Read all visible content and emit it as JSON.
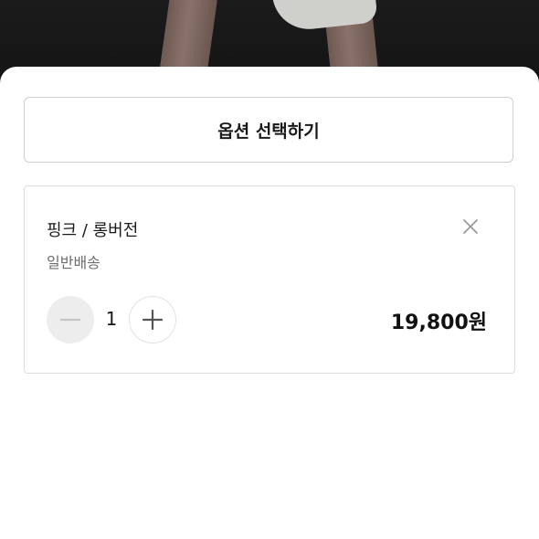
{
  "sheet": {
    "select_option_label": "옵션 선택하기"
  },
  "selected_option": {
    "name": "핑크 / 롱버전",
    "shipping": "일반배송",
    "quantity": "1",
    "price": "19,800원"
  },
  "icons": {
    "remove": "close-icon",
    "decrease": "minus-icon",
    "increase": "plus-icon"
  },
  "colors": {
    "sheet_background": "#ffffff",
    "minus_button_fill": "#ededed",
    "border": "#cfcfcf",
    "secondary_text": "#6d6d6d"
  }
}
